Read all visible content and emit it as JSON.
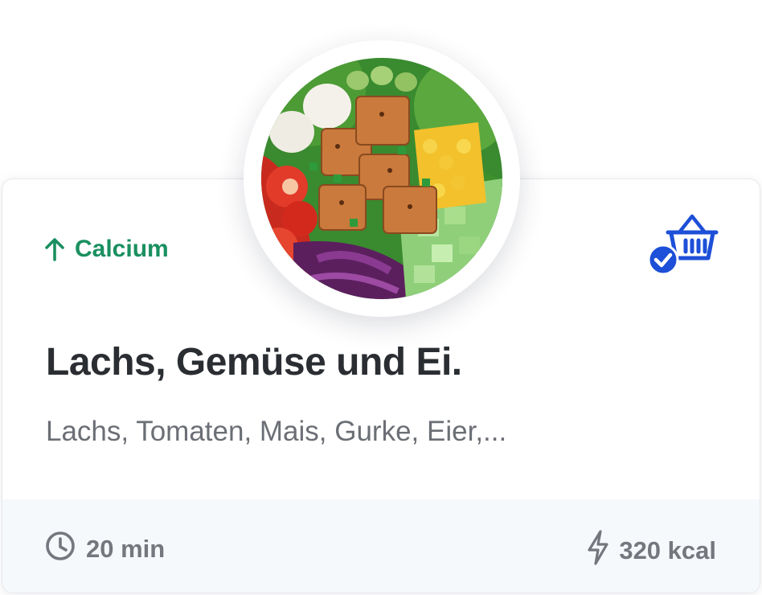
{
  "recipe": {
    "nutrient_tag": "Calcium",
    "title": "Lachs, Gemüse und Ei.",
    "ingredients": "Lachs, Tomaten, Mais, Gurke, Eier,...",
    "duration": "20 min",
    "calories": "320 kcal"
  },
  "icons": {
    "nutrient": "arrow-up-icon",
    "basket": "shopping-basket-check-icon",
    "duration": "clock-icon",
    "calories": "lightning-icon"
  },
  "colors": {
    "accent_green": "#1a8f5f",
    "accent_blue": "#1d4fd8",
    "title_text": "#2a2d31",
    "muted_text": "#6b6f75",
    "footer_bg": "#f5f9fc"
  }
}
